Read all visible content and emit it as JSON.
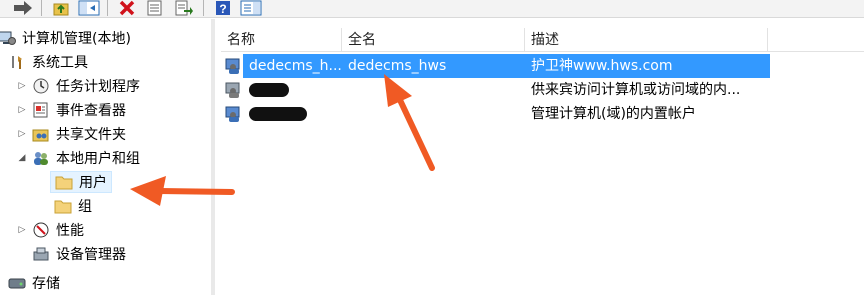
{
  "toolbar": {
    "buttons": [
      {
        "icon": "forward-arrow-icon"
      },
      {
        "icon": "up-folder-icon"
      },
      {
        "icon": "show-hide-tree-icon"
      },
      {
        "icon": "delete-x-icon"
      },
      {
        "icon": "properties-icon"
      },
      {
        "icon": "export-list-icon"
      },
      {
        "icon": "help-icon"
      },
      {
        "icon": "show-action-pane-icon"
      }
    ]
  },
  "tree": {
    "root": {
      "label": "计算机管理(本地)",
      "icon": "computer-management-icon"
    },
    "system_tools": {
      "label": "系统工具",
      "icon": "tools-icon"
    },
    "task_scheduler": {
      "label": "任务计划程序",
      "icon": "clock-icon"
    },
    "event_viewer": {
      "label": "事件查看器",
      "icon": "event-viewer-icon"
    },
    "shared_folders": {
      "label": "共享文件夹",
      "icon": "shared-folder-icon"
    },
    "local_users_groups": {
      "label": "本地用户和组",
      "icon": "users-group-icon"
    },
    "users": {
      "label": "用户",
      "icon": "folder-icon"
    },
    "groups": {
      "label": "组",
      "icon": "folder-icon"
    },
    "performance": {
      "label": "性能",
      "icon": "performance-icon"
    },
    "device_manager": {
      "label": "设备管理器",
      "icon": "device-manager-icon"
    },
    "storage": {
      "label": "存储",
      "icon": "storage-icon"
    }
  },
  "list": {
    "columns": [
      "名称",
      "全名",
      "描述"
    ],
    "rows": [
      {
        "name": "dedecms_h...",
        "full_name": "dedecms_hws",
        "description": "护卫神www.hws.com",
        "selected": true
      },
      {
        "name": "",
        "full_name": "",
        "description": "供来宾访问计算机或访问域的内...",
        "selected": false
      },
      {
        "name": "",
        "full_name": "",
        "description": "管理计算机(域)的内置帐户",
        "selected": false
      }
    ]
  },
  "colors": {
    "selection": "#3399ff",
    "annotation_arrow": "#f05a24"
  }
}
